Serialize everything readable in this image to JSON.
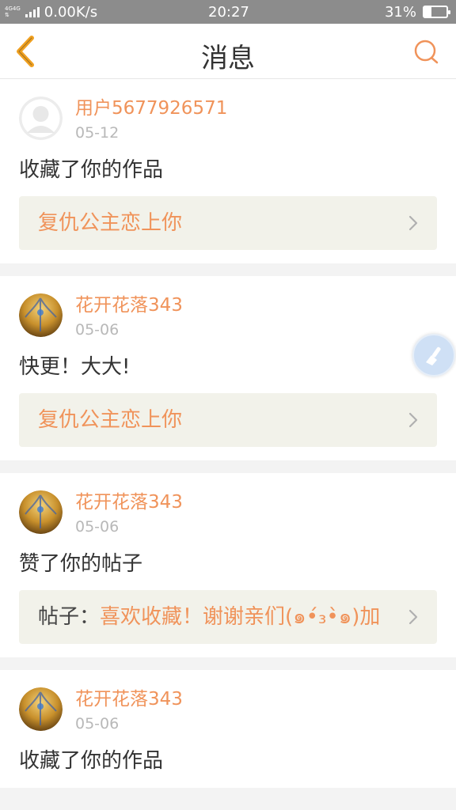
{
  "status_bar": {
    "network": "4G 4G",
    "speed": "0.00K/s",
    "time": "20:27",
    "battery": "31%",
    "battery_level": 0.31
  },
  "header": {
    "title": "消息",
    "back_icon": "back-chevron-icon",
    "search_icon": "search-icon",
    "accent_color": "#f0935a"
  },
  "messages": [
    {
      "user": "用户5677926571",
      "date": "05-12",
      "text": "收藏了你的作品",
      "ref_prefix": "",
      "ref_title": "复仇公主恋上你",
      "avatar": "default-avatar"
    },
    {
      "user": "花开花落343",
      "date": "05-06",
      "text": "快更！大大!",
      "ref_prefix": "",
      "ref_title": "复仇公主恋上你",
      "avatar": "flower-avatar"
    },
    {
      "user": "花开花落343",
      "date": "05-06",
      "text": "赞了你的帖子",
      "ref_prefix": "帖子：",
      "ref_title": "喜欢收藏！谢谢亲们(๑•́₃•̀๑)加",
      "avatar": "flower-avatar"
    },
    {
      "user": "花开花落343",
      "date": "05-06",
      "text": "收藏了你的作品",
      "ref_prefix": "",
      "ref_title": "",
      "avatar": "flower-avatar"
    }
  ]
}
